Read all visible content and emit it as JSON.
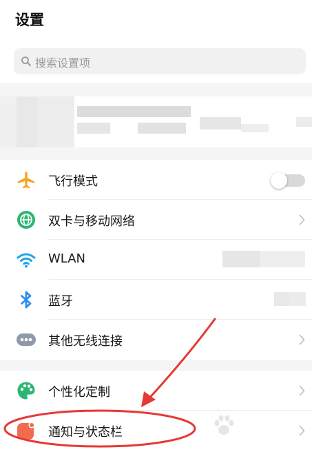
{
  "header": {
    "title": "设置"
  },
  "search": {
    "placeholder": "搜索设置项",
    "icon": "search-icon"
  },
  "colors": {
    "accent_orange": "#f5a623",
    "mobile_green": "#2bb673",
    "wifi_blue": "#1aa3ec",
    "bluetooth_blue": "#2a8cf0",
    "more_gray": "#8e9aa8",
    "annotation_red": "#e53935"
  },
  "sections": [
    {
      "items": [
        {
          "label": "飞行模式",
          "icon": "airplane-icon",
          "control": "toggle",
          "toggle_on": false
        },
        {
          "label": "双卡与移动网络",
          "icon": "globe-icon",
          "control": "chevron"
        },
        {
          "label": "WLAN",
          "icon": "wifi-icon",
          "control": "blurred-value"
        },
        {
          "label": "蓝牙",
          "icon": "bluetooth-icon",
          "control": "blurred-value"
        },
        {
          "label": "其他无线连接",
          "icon": "more-icon",
          "control": "chevron"
        }
      ]
    },
    {
      "items": [
        {
          "label": "个性化定制",
          "icon": "palette-icon",
          "control": "chevron"
        },
        {
          "label": "通知与状态栏",
          "icon": "notification-icon",
          "control": "chevron",
          "highlighted": true
        }
      ]
    }
  ]
}
